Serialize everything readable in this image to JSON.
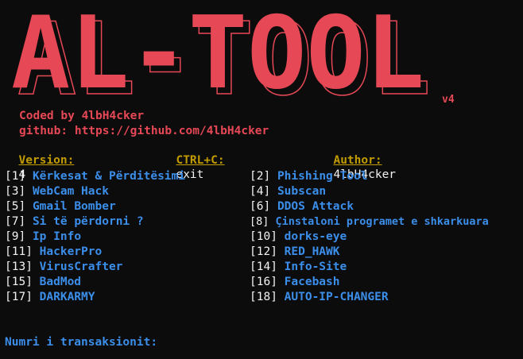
{
  "banner": {
    "text": "AL-TOOL",
    "version_tag": "v4",
    "color": "#e74856"
  },
  "credits": {
    "coded_by": "Coded by 4lbH4cker",
    "github": "github: https://github.com/4lbH4cker"
  },
  "status": {
    "version_label": "Version:",
    "version_value": "4",
    "ctrl_label": "CTRL+C:",
    "ctrl_value": "exit",
    "author_label": "Author:",
    "author_value": "4lbH4cker"
  },
  "menu": {
    "left": [
      {
        "num": "[1]",
        "label": "Kërkesat & Përditësimi"
      },
      {
        "num": "[3]",
        "label": "WebCam Hack"
      },
      {
        "num": "[5]",
        "label": "Gmail Bomber"
      },
      {
        "num": "[7]",
        "label": "Si të përdorni ?"
      },
      {
        "num": "[9]",
        "label": "Ip Info"
      },
      {
        "num": "[11]",
        "label": "HackerPro"
      },
      {
        "num": "[13]",
        "label": "VirusCrafter"
      },
      {
        "num": "[15]",
        "label": "BadMod"
      },
      {
        "num": "[17]",
        "label": "DARKARMY"
      }
    ],
    "right": [
      {
        "num": "[2]",
        "label": "Phishing Tool"
      },
      {
        "num": "[4]",
        "label": "Subscan"
      },
      {
        "num": "[6]",
        "label": "DDOS Attack"
      },
      {
        "num": "[8]",
        "label": "Çinstaloni programet e shkarkuara"
      },
      {
        "num": "[10]",
        "label": "dorks-eye"
      },
      {
        "num": "[12]",
        "label": "RED_HAWK"
      },
      {
        "num": "[14]",
        "label": "Info-Site"
      },
      {
        "num": "[16]",
        "label": "Facebash"
      },
      {
        "num": "[18]",
        "label": "AUTO-IP-CHANGER"
      }
    ]
  },
  "prompt": {
    "label": "Numri i transaksionit:"
  }
}
